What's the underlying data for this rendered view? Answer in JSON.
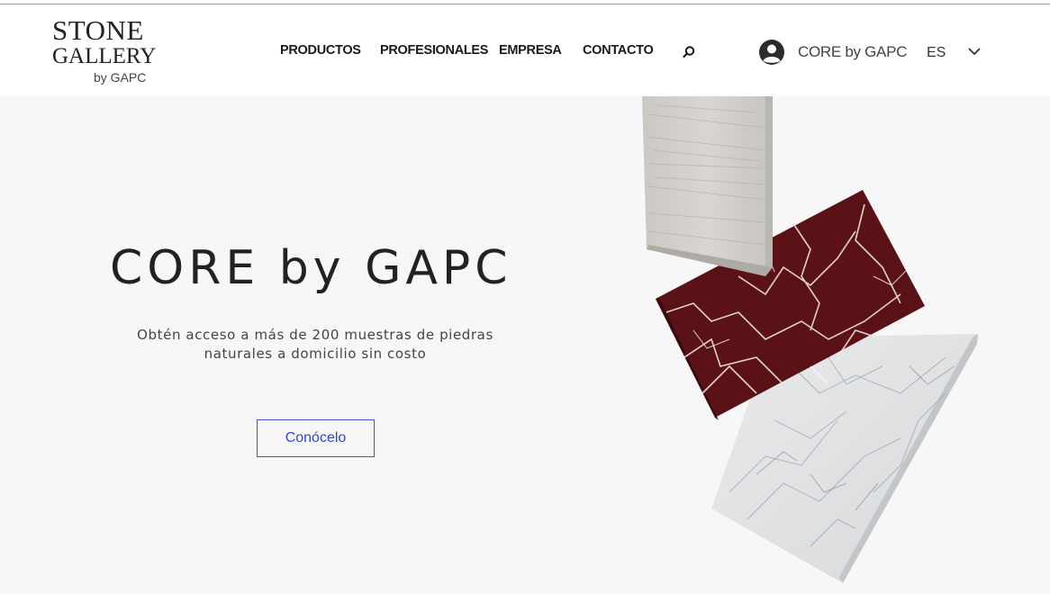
{
  "brand": {
    "logo_line1": "STONE",
    "logo_line2": "GALLERY",
    "logo_line3": "by GAPC"
  },
  "nav": {
    "items": [
      {
        "label": "PRODUCTOS"
      },
      {
        "label": "PROFESIONALES"
      },
      {
        "label": "EMPRESA"
      },
      {
        "label": "CONTACTO"
      }
    ],
    "search_icon": "search-icon"
  },
  "account": {
    "label": "CORE by GAPC",
    "icon": "user-avatar-icon"
  },
  "language": {
    "selected": "ES",
    "icon": "chevron-down-icon"
  },
  "hero": {
    "title": "CORE by GAPC",
    "subtitle_line1": "Obtén acceso a más de 200 muestras de piedras",
    "subtitle_line2": "naturales a domicilio sin costo",
    "cta_label": "Conócelo"
  },
  "colors": {
    "accent": "#3346c8",
    "background": "#f7f7f7",
    "header": "#ffffff",
    "text": "#222222"
  }
}
